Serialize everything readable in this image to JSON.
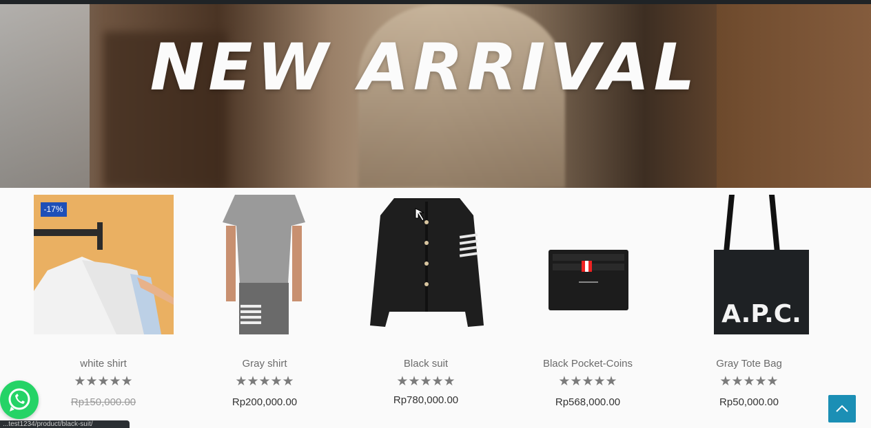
{
  "hero": {
    "title": "NEW ARRIVAL"
  },
  "products": [
    {
      "name": "white shirt",
      "price": "Rp150,000.00",
      "on_sale": true,
      "badge": "-17%",
      "rating": 5,
      "stars": "★★★★★"
    },
    {
      "name": "Gray shirt",
      "price": "Rp200,000.00",
      "on_sale": false,
      "rating": 5,
      "stars": "★★★★★"
    },
    {
      "name": "Black suit",
      "price": "Rp780,000.00",
      "on_sale": false,
      "rating": 5,
      "stars": "★★★★★"
    },
    {
      "name": "Black Pocket-Coins",
      "price": "Rp568,000.00",
      "on_sale": false,
      "rating": 5,
      "stars": "★★★★★"
    },
    {
      "name": "Gray Tote Bag",
      "price": "Rp50,000.00",
      "on_sale": false,
      "rating": 5,
      "stars": "★★★★★",
      "bag_print": "A.P.C."
    }
  ],
  "status_bar": {
    "url": "...test1234/product/black-suit/"
  },
  "icons": {
    "whatsapp": "whatsapp-icon",
    "scroll_top": "chevron-up-icon"
  },
  "colors": {
    "badge": "#1e4fb8",
    "whatsapp": "#25d366",
    "scroll_top": "#1b8fb5"
  }
}
